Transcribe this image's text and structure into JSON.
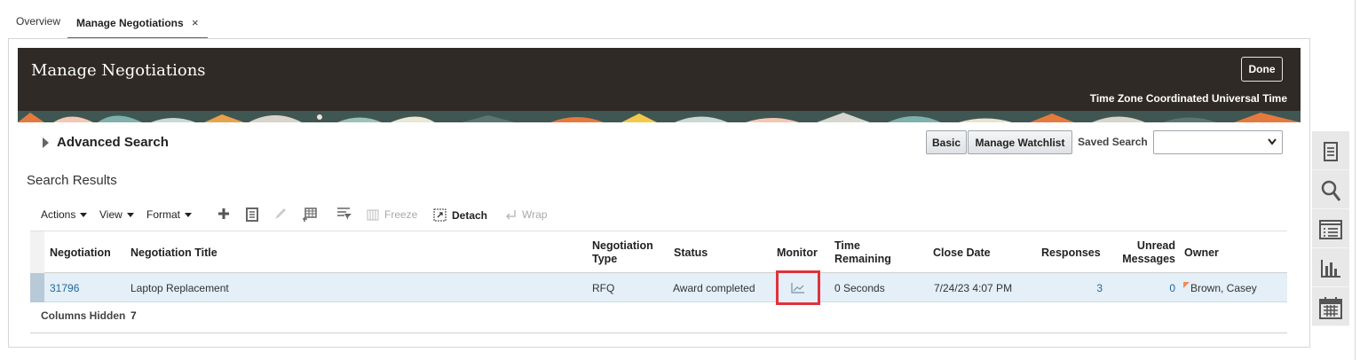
{
  "tabs": {
    "overview": "Overview",
    "active": "Manage Negotiations",
    "close": "×"
  },
  "header": {
    "title": "Manage Negotiations",
    "done": "Done",
    "timezone": "Time Zone Coordinated Universal Time"
  },
  "search": {
    "advanced": "Advanced Search",
    "basic": "Basic",
    "manage_watchlist": "Manage Watchlist",
    "saved_search_label": "Saved Search",
    "saved_search_value": ""
  },
  "results": {
    "title": "Search Results",
    "toolbar": {
      "actions": "Actions",
      "view": "View",
      "format": "Format",
      "freeze": "Freeze",
      "detach": "Detach",
      "wrap": "Wrap"
    },
    "columns": {
      "negotiation": "Negotiation",
      "title": "Negotiation Title",
      "type_1": "Negotiation",
      "type_2": "Type",
      "status": "Status",
      "monitor": "Monitor",
      "time_1": "Time",
      "time_2": "Remaining",
      "close_date": "Close Date",
      "responses": "Responses",
      "unread_1": "Unread",
      "unread_2": "Messages",
      "owner": "Owner"
    },
    "rows": [
      {
        "negotiation": "31796",
        "title": "Laptop Replacement",
        "type": "RFQ",
        "status": "Award completed",
        "time_remaining": "0 Seconds",
        "close_date": "7/24/23 4:07 PM",
        "responses": "3",
        "unread": "0",
        "owner": "Brown, Casey"
      }
    ],
    "columns_hidden_label": "Columns Hidden",
    "columns_hidden_value": "7"
  },
  "icons": {
    "rail": [
      "document-icon",
      "search-icon",
      "list-icon",
      "bar-chart-icon",
      "calendar-icon"
    ],
    "monitor": "line-chart-icon"
  },
  "colors": {
    "banner": "#2f2a26",
    "link": "#1e6a9c",
    "selected_row": "#e4eff8",
    "highlight": "#e0323a",
    "active_tab": "#4a7a4e"
  }
}
